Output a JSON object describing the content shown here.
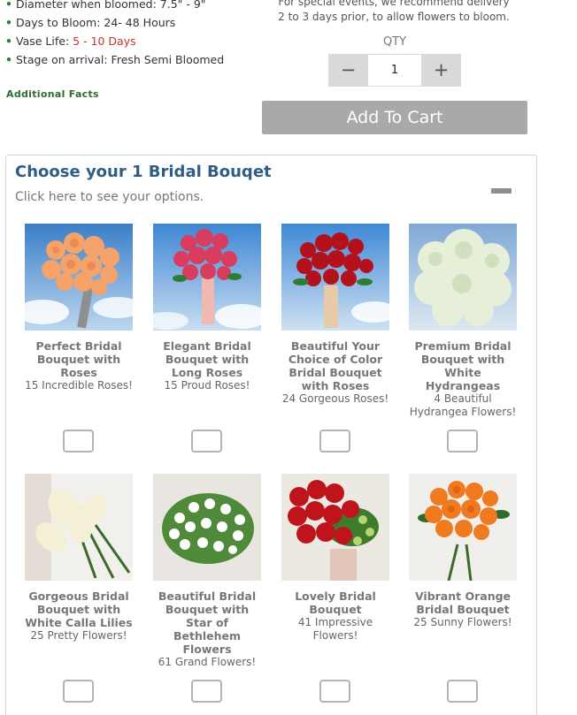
{
  "facts": [
    {
      "label": "Diameter when bloomed: ",
      "value": "7.5\" - 9\"",
      "highlight": false
    },
    {
      "label": "Days to Bloom: ",
      "value": "24- 48 Hours",
      "highlight": false
    },
    {
      "label": "Vase Life: ",
      "value": "5 - 10 Days",
      "highlight": true
    },
    {
      "label": "Stage on arrival: ",
      "value": "Fresh Semi Bloomed",
      "highlight": false
    }
  ],
  "additional_facts": "Additional Facts",
  "delivery_note": {
    "line1": "For special events, we recommend delivery",
    "line2": "2 to 3 days prior, to allow flowers to bloom."
  },
  "qty": {
    "label": "QTY",
    "minus": "−",
    "value": "1",
    "plus": "+"
  },
  "add_to_cart": "Add To Cart",
  "panel": {
    "title": "Choose your 1 Bridal Bouqet",
    "subtitle": "Click here to see your options."
  },
  "colors": {
    "title_blue": "#2f5d86",
    "bullet_green": "#2e7d32",
    "vase_life_red": "#c0392b",
    "button_gray": "#a9a9a9"
  },
  "products": [
    {
      "name": "Perfect Bridal Bouquet with Roses",
      "desc": "15 Incredible Roses!",
      "image": "peach-roses-bouquet"
    },
    {
      "name": "Elegant Bridal Bouquet with Long Roses",
      "desc": "15 Proud Roses!",
      "image": "pink-roses-bouquet"
    },
    {
      "name": "Beautiful Your Choice of Color Bridal Bouquet with Roses",
      "desc": "24 Gorgeous Roses!",
      "image": "red-roses-bouquet"
    },
    {
      "name": "Premium Bridal Bouquet with White Hydrangeas",
      "desc": "4 Beautiful Hydrangea Flowers!",
      "image": "white-hydrangea-bouquet"
    },
    {
      "name": "Gorgeous Bridal Bouquet with White Calla Lilies",
      "desc": "25 Pretty Flowers!",
      "image": "calla-lily-bouquet"
    },
    {
      "name": "Beautiful Bridal Bouquet with Star of Bethlehem Flowers",
      "desc": "61 Grand Flowers!",
      "image": "star-of-bethlehem-bouquet"
    },
    {
      "name": "Lovely Bridal Bouquet",
      "desc": "41 Impressive Flowers!",
      "image": "red-roses-green-bouquet"
    },
    {
      "name": "Vibrant Orange Bridal Bouquet",
      "desc": "25 Sunny Flowers!",
      "image": "orange-bouquet"
    }
  ]
}
